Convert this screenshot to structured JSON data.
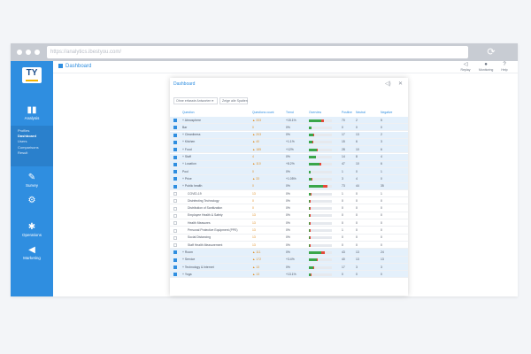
{
  "browser": {
    "url": "https://analytics.ibestyou.com/"
  },
  "app": {
    "logo": "TY"
  },
  "sidebar": {
    "analysis_label": "Analysis",
    "sub_items": [
      "Profiles",
      "Dashboard",
      "Users",
      "Comparisons",
      "Result"
    ],
    "survey_label": "Survey",
    "operations_label": "Operations",
    "marketing_label": "Marketing"
  },
  "header": {
    "breadcrumb": "Dashboard"
  },
  "toolbar": {
    "items": [
      "Replay",
      "Monitoring",
      "Help"
    ]
  },
  "panel": {
    "title": "Dashboard",
    "filters": [
      "Ohne erfasste Antworten",
      "Zeige alle Spalten"
    ],
    "columns": [
      "Question",
      "Questions count",
      "Trend",
      "Overview",
      "Positive",
      "Neutral",
      "Negative"
    ]
  },
  "rows": [
    {
      "label": "+ Atmosphere",
      "count": "▲ 333",
      "trend": "+15.1%",
      "green": 0.55,
      "red": 0.1,
      "pos": "70",
      "neu": "2",
      "neg": "5",
      "sel": true
    },
    {
      "label": "Bar",
      "count": "0",
      "trend": "0%",
      "green": 0.1,
      "red": 0.0,
      "pos": "0",
      "neu": "0",
      "neg": "0",
      "sel": true
    },
    {
      "label": "+ Cleanliness",
      "count": "▲ 203",
      "trend": "0%",
      "green": 0.2,
      "red": 0.05,
      "pos": "17",
      "neu": "13",
      "neg": "2",
      "sel": true
    },
    {
      "label": "+ Kitchen",
      "count": "▲ 40",
      "trend": "+1.1%",
      "green": 0.15,
      "red": 0.03,
      "pos": "15",
      "neu": "6",
      "neg": "3",
      "sel": true
    },
    {
      "label": "+ Food",
      "count": "▲ 185",
      "trend": "+12%",
      "green": 0.35,
      "red": 0.05,
      "pos": "28",
      "neu": "10",
      "neg": "6",
      "sel": true
    },
    {
      "label": "+ Staff",
      "count": "4",
      "trend": "0%",
      "green": 0.3,
      "red": 0.0,
      "pos": "14",
      "neu": "8",
      "neg": "4",
      "sel": true
    },
    {
      "label": "+ Location",
      "count": "▲ 110",
      "trend": "+8.2%",
      "green": 0.45,
      "red": 0.08,
      "pos": "47",
      "neu": "10",
      "neg": "6",
      "sel": true
    },
    {
      "label": "Pool",
      "count": "0",
      "trend": "0%",
      "green": 0.08,
      "red": 0.0,
      "pos": "1",
      "neu": "0",
      "neg": "1",
      "sel": true
    },
    {
      "label": "+ Price",
      "count": "▲ 33",
      "trend": "+1.05%",
      "green": 0.12,
      "red": 0.03,
      "pos": "3",
      "neu": "4",
      "neg": "0",
      "sel": true
    },
    {
      "label": "+ Public health",
      "count": "0",
      "trend": "0%",
      "green": 0.6,
      "red": 0.2,
      "pos": "73",
      "neu": "44",
      "neg": "35",
      "sel": true
    },
    {
      "label": "COVID-19",
      "count": "13",
      "trend": "0%",
      "green": 0.08,
      "red": 0.02,
      "pos": "1",
      "neu": "0",
      "neg": "1",
      "sel": false
    },
    {
      "label": "Disinfecting Technology",
      "count": "0",
      "trend": "0%",
      "green": 0.04,
      "red": 0.02,
      "pos": "0",
      "neu": "0",
      "neg": "0",
      "sel": false
    },
    {
      "label": "Distribution of Sanitization",
      "count": "0",
      "trend": "0%",
      "green": 0.04,
      "red": 0.02,
      "pos": "0",
      "neu": "0",
      "neg": "0",
      "sel": false
    },
    {
      "label": "Employee Health & Safety",
      "count": "13",
      "trend": "0%",
      "green": 0.04,
      "red": 0.02,
      "pos": "0",
      "neu": "0",
      "neg": "0",
      "sel": false
    },
    {
      "label": "Health Measures",
      "count": "13",
      "trend": "0%",
      "green": 0.04,
      "red": 0.02,
      "pos": "0",
      "neu": "0",
      "neg": "0",
      "sel": false
    },
    {
      "label": "Personal Protective Equipment (PPE)",
      "count": "13",
      "trend": "0%",
      "green": 0.04,
      "red": 0.02,
      "pos": "1",
      "neu": "0",
      "neg": "0",
      "sel": false
    },
    {
      "label": "Social Distancing",
      "count": "13",
      "trend": "0%",
      "green": 0.04,
      "red": 0.02,
      "pos": "0",
      "neu": "0",
      "neg": "0",
      "sel": false
    },
    {
      "label": "Staff Health Measurement",
      "count": "13",
      "trend": "0%",
      "green": 0.04,
      "red": 0.02,
      "pos": "0",
      "neu": "0",
      "neg": "0",
      "sel": false
    },
    {
      "label": "+ Room",
      "count": "▲ 111",
      "trend": "0%",
      "green": 0.55,
      "red": 0.15,
      "pos": "43",
      "neu": "13",
      "neg": "24",
      "sel": true
    },
    {
      "label": "+ Service",
      "count": "▲ 172",
      "trend": "+3.4%",
      "green": 0.35,
      "red": 0.05,
      "pos": "40",
      "neu": "13",
      "neg": "13",
      "sel": true
    },
    {
      "label": "+ Technology & Internet",
      "count": "▲ 13",
      "trend": "0%",
      "green": 0.18,
      "red": 0.03,
      "pos": "17",
      "neu": "3",
      "neg": "3",
      "sel": true
    },
    {
      "label": "+ Yoga",
      "count": "▲ 13",
      "trend": "+13.1%",
      "green": 0.08,
      "red": 0.01,
      "pos": "0",
      "neu": "0",
      "neg": "0",
      "sel": true
    }
  ]
}
